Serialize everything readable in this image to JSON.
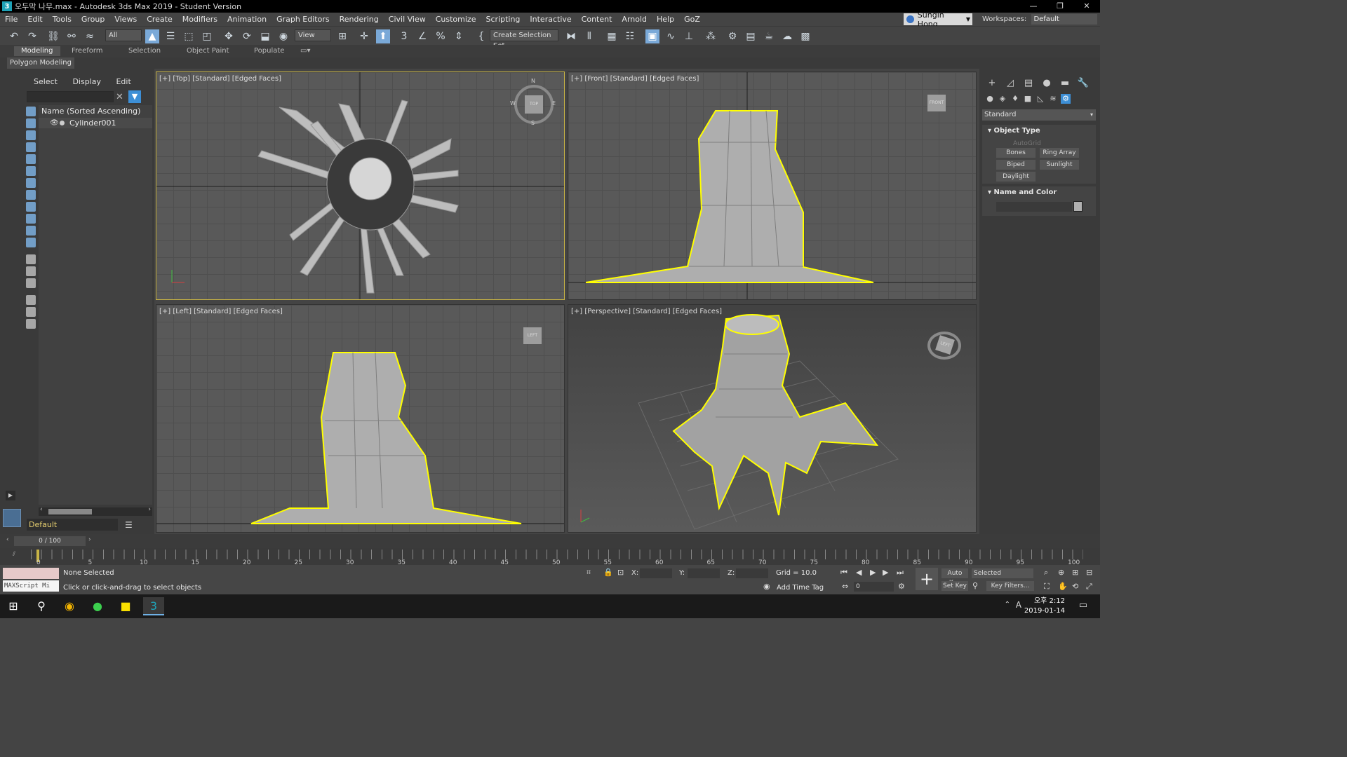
{
  "window": {
    "title": "오두막 나무.max - Autodesk 3ds Max 2019 - Student Version",
    "app_icon": "3",
    "minimize": "—",
    "restore": "❐",
    "close": "✕"
  },
  "menu": [
    "File",
    "Edit",
    "Tools",
    "Group",
    "Views",
    "Create",
    "Modifiers",
    "Animation",
    "Graph Editors",
    "Rendering",
    "Civil View",
    "Customize",
    "Scripting",
    "Interactive",
    "Content",
    "Arnold",
    "Help",
    "GoZ"
  ],
  "user": {
    "name": "Sungin Hong"
  },
  "workspaces": {
    "label": "Workspaces:",
    "value": "Default"
  },
  "toolbar": {
    "filter": "All",
    "ref_coord": "View",
    "selection_set": "Create Selection Set",
    "percent_glyph": "%"
  },
  "ribbon": {
    "tabs": [
      "Modeling",
      "Freeform",
      "Selection",
      "Object Paint",
      "Populate"
    ],
    "active_tab": "Modeling",
    "sub_label": "Polygon Modeling"
  },
  "explorer": {
    "tabs": [
      "Select",
      "Display",
      "Edit"
    ],
    "column_header": "Name (Sorted Ascending)",
    "items": [
      {
        "name": "Cylinder001"
      }
    ],
    "layer": "Default"
  },
  "viewports": {
    "top": "[+] [Top] [Standard] [Edged Faces]",
    "front": "[+] [Front] [Standard] [Edged Faces]",
    "left": "[+] [Left] [Standard] [Edged Faces]",
    "perspective": "[+] [Perspective] [Standard] [Edged Faces]",
    "compass": {
      "n": "N",
      "s": "S",
      "e": "E",
      "w": "W",
      "cube": "TOP"
    },
    "cube_front": "FRONT",
    "cube_left": "LEFT",
    "cube_persp": "LEFT"
  },
  "command_panel": {
    "category": "Standard",
    "object_type": {
      "title": "Object Type",
      "autogrid": "AutoGrid",
      "buttons": [
        "Bones",
        "Ring Array",
        "Biped",
        "Sunlight",
        "Daylight"
      ]
    },
    "name_color": {
      "title": "Name and Color"
    }
  },
  "timeline": {
    "frame": "0 / 100",
    "ticks": [
      "0",
      "5",
      "10",
      "15",
      "20",
      "25",
      "30",
      "35",
      "40",
      "45",
      "50",
      "55",
      "60",
      "65",
      "70",
      "75",
      "80",
      "85",
      "90",
      "95",
      "100"
    ]
  },
  "status": {
    "maxscript": "MAXScript Mi",
    "selection": "None Selected",
    "prompt": "Click or click-and-drag to select objects",
    "x_label": "X:",
    "y_label": "Y:",
    "z_label": "Z:",
    "grid": "Grid = 10.0",
    "add_time_tag": "Add Time Tag",
    "auto_key": "Auto Key",
    "set_key": "Set Key",
    "key_mode": "Selected",
    "key_filters": "Key Filters...",
    "frame_input": "0"
  },
  "taskbar": {
    "time": "오후 2:12",
    "date": "2019-01-14",
    "ime": "A"
  },
  "colors": {
    "selection": "#ffff00",
    "active_viewport": "#c8b445",
    "accent": "#3d8fd6"
  }
}
